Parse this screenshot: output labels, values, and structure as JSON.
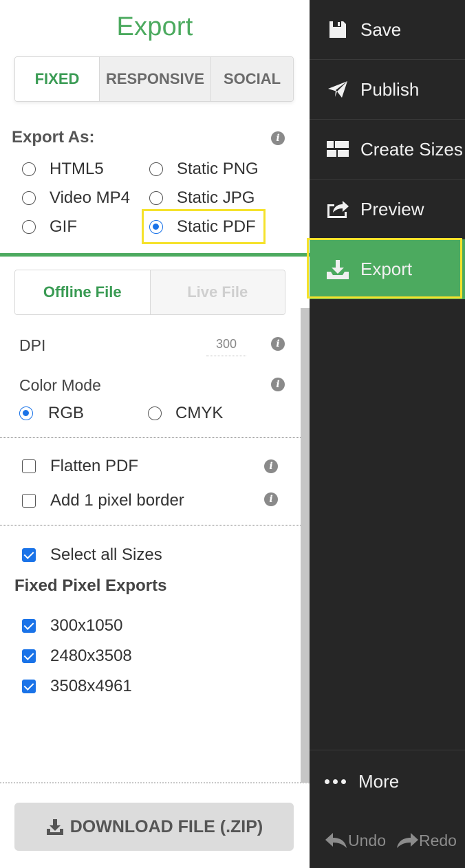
{
  "panel": {
    "title": "Export",
    "tabs": [
      "FIXED",
      "RESPONSIVE",
      "SOCIAL"
    ],
    "active_tab": "FIXED",
    "export_as_label": "Export As:",
    "formats": [
      {
        "label": "HTML5",
        "checked": false
      },
      {
        "label": "Static PNG",
        "checked": false
      },
      {
        "label": "Video MP4",
        "checked": false
      },
      {
        "label": "Static JPG",
        "checked": false
      },
      {
        "label": "GIF",
        "checked": false
      },
      {
        "label": "Static PDF",
        "checked": true
      }
    ],
    "file_tabs": [
      "Offline File",
      "Live File"
    ],
    "active_file_tab": "Offline File",
    "dpi_label": "DPI",
    "dpi_value": "300",
    "color_mode_label": "Color Mode",
    "color_modes": [
      {
        "label": "RGB",
        "checked": true
      },
      {
        "label": "CMYK",
        "checked": false
      }
    ],
    "options": [
      {
        "label": "Flatten PDF",
        "checked": false
      },
      {
        "label": "Add 1 pixel border",
        "checked": false
      }
    ],
    "select_all": {
      "label": "Select all Sizes",
      "checked": true
    },
    "fixed_exports_heading": "Fixed Pixel Exports",
    "sizes": [
      {
        "label": "300x1050",
        "checked": true
      },
      {
        "label": "2480x3508",
        "checked": true
      },
      {
        "label": "3508x4961",
        "checked": true
      }
    ],
    "download_button": "DOWNLOAD FILE (.ZIP)"
  },
  "sidebar": {
    "items": [
      {
        "label": "Save",
        "icon": "floppy-disk-icon"
      },
      {
        "label": "Publish",
        "icon": "paper-plane-icon"
      },
      {
        "label": "Create Sizes",
        "icon": "grid-icon"
      },
      {
        "label": "Preview",
        "icon": "share-icon"
      },
      {
        "label": "Export",
        "icon": "download-tray-icon",
        "active": true
      }
    ],
    "more": "More",
    "undo": "Undo",
    "redo": "Redo"
  },
  "colors": {
    "accent_green": "#4caa5f",
    "sidebar_bg": "#262626",
    "highlight_yellow": "#f5e22b",
    "checkbox_blue": "#1a73e8"
  }
}
